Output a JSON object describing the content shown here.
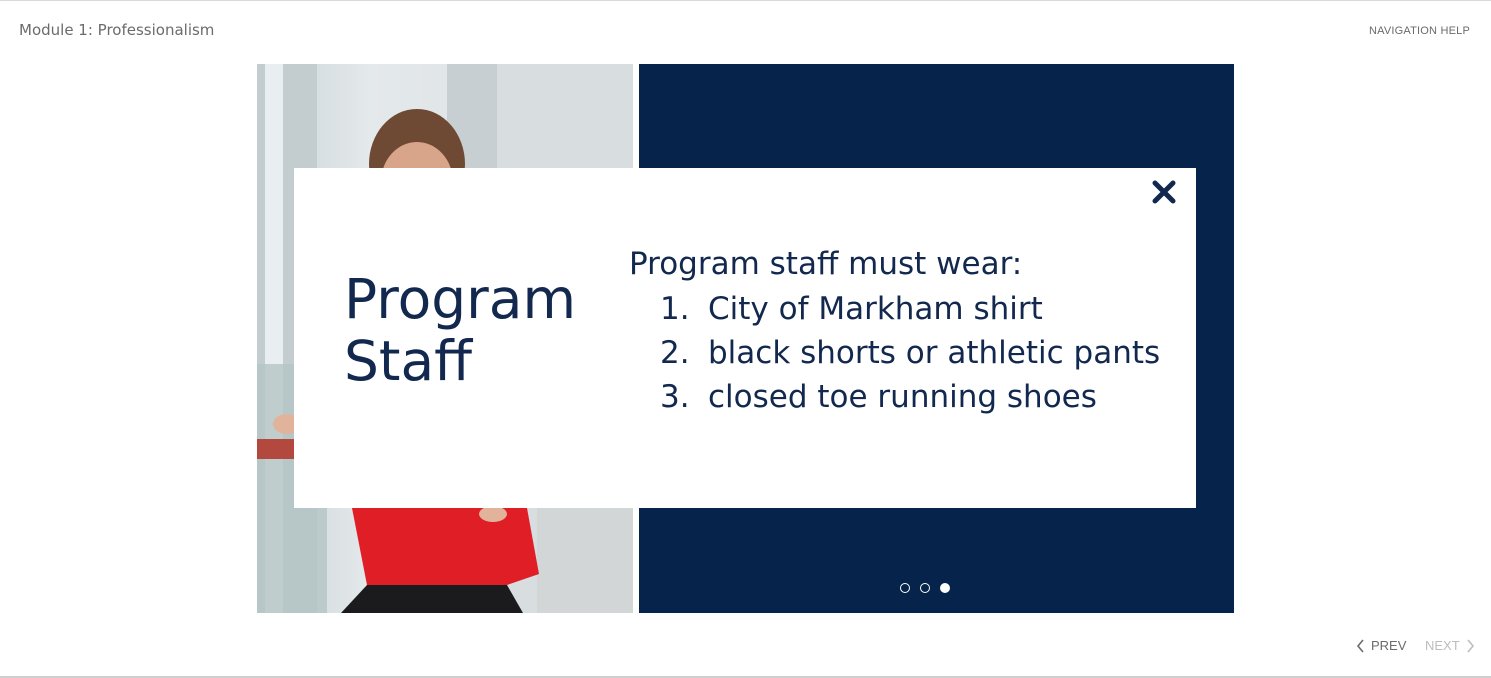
{
  "header": {
    "module_title": "Module 1: Professionalism",
    "nav_help": "NAVIGATION HELP"
  },
  "popup": {
    "title_line1": "Program",
    "title_line2": "Staff",
    "intro": "Program staff must wear:",
    "items": [
      {
        "num": "1.",
        "text": "City of Markham shirt"
      },
      {
        "num": "2.",
        "text": "black shorts or athletic pants"
      },
      {
        "num": "3.",
        "text": "closed toe running shoes"
      }
    ],
    "close_icon": "close-icon"
  },
  "pagination": {
    "total": 3,
    "active": 3
  },
  "footer": {
    "prev_label": "PREV",
    "next_label": "NEXT"
  },
  "colors": {
    "navy": "#06244b",
    "text_navy": "#12284e",
    "shirt_red": "#e01e26"
  }
}
